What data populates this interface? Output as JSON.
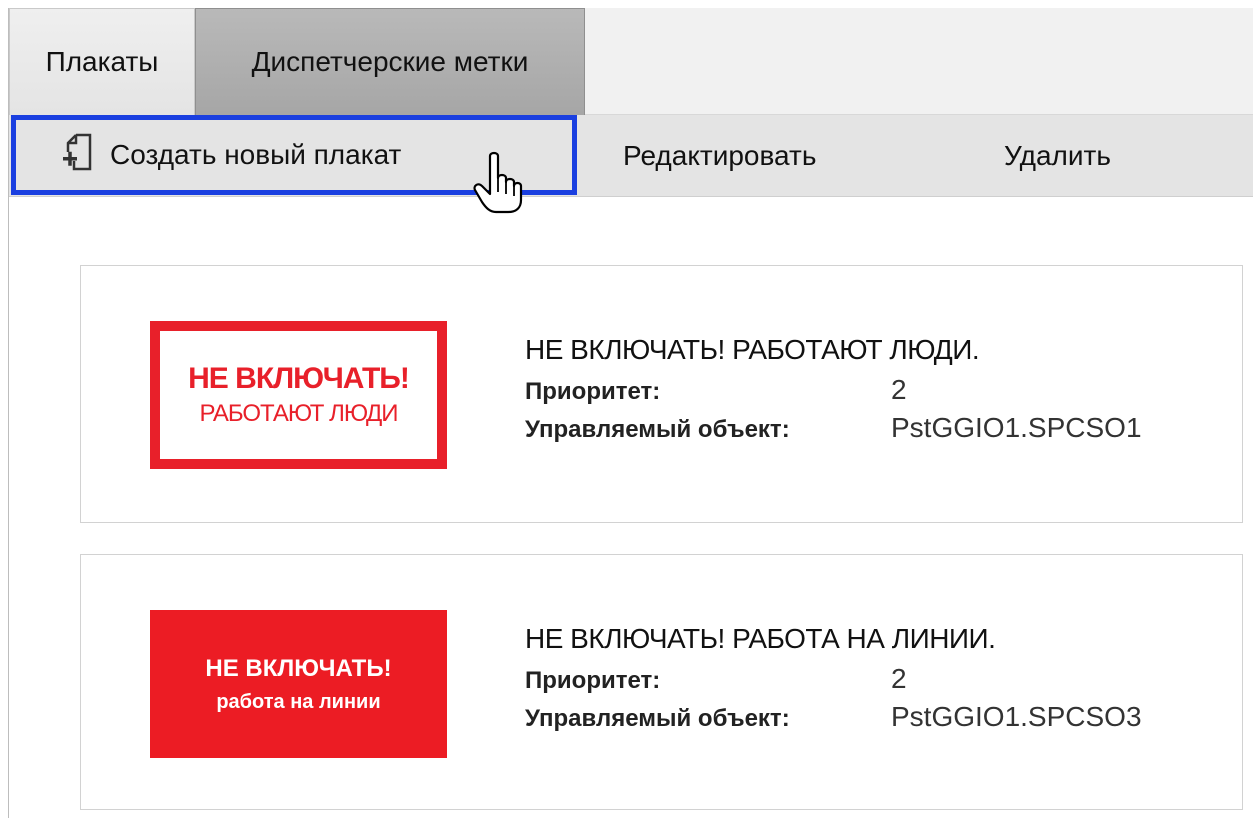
{
  "tabs": [
    {
      "label": "Плакаты",
      "active": true
    },
    {
      "label": "Диспетчерские метки",
      "active": false
    }
  ],
  "toolbar": {
    "create_label": "Создать новый плакат",
    "edit_label": "Редактировать",
    "delete_label": "Удалить"
  },
  "cards": [
    {
      "poster": {
        "line1": "НЕ ВКЛЮЧАТЬ!",
        "line2": "РАБОТАЮТ ЛЮДИ",
        "style": "outlined",
        "color": "#e8202a"
      },
      "title": "НЕ ВКЛЮЧАТЬ! РАБОТАЮТ ЛЮДИ.",
      "priority_label": "Приоритет:",
      "priority_value": "2",
      "object_label": "Управляемый объект:",
      "object_value": "PstGGIO1.SPCSO1"
    },
    {
      "poster": {
        "line1": "НЕ ВКЛЮЧАТЬ!",
        "line2": "работа на линии",
        "style": "filled",
        "color": "#ec1c24"
      },
      "title": "НЕ ВКЛЮЧАТЬ! РАБОТА НА ЛИНИИ.",
      "priority_label": "Приоритет:",
      "priority_value": "2",
      "object_label": "Управляемый объект:",
      "object_value": "PstGGIO1.SPCSO3"
    }
  ],
  "colors": {
    "focus_border": "#1a3fe0",
    "active_tab": "#e8e8e8",
    "inactive_tab": "#aaaaaa"
  },
  "icons": {
    "create": "new-document-plus-icon",
    "cursor": "hand-pointer-icon"
  }
}
